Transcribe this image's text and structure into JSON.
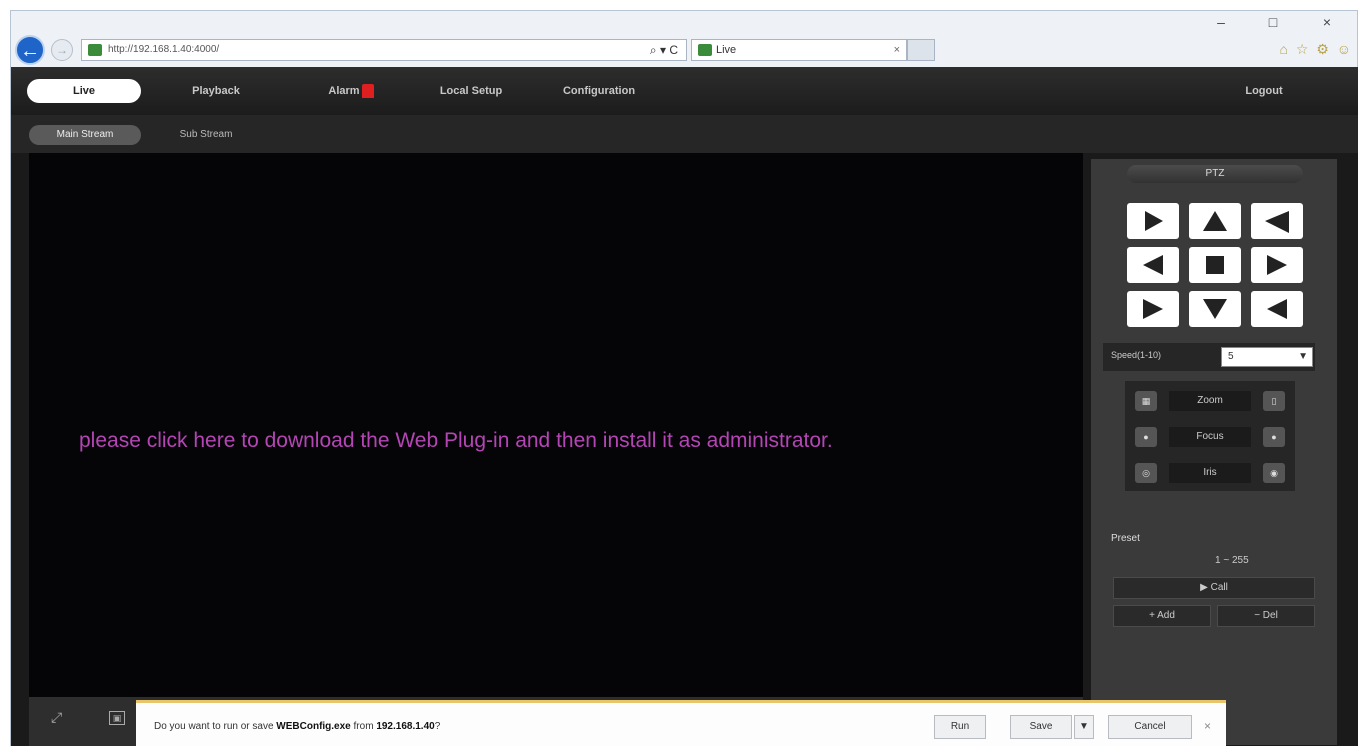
{
  "browser": {
    "url": "http://192.168.1.40:4000/",
    "url_tools": "⌕ ▾ C",
    "tab_title": "Live",
    "tab_close": "×",
    "window_minimize": "–",
    "window_maximize": "□",
    "window_close": "×",
    "toolbar_icons": "⌂ ☆ ⚙ ☺"
  },
  "topnav": {
    "items": [
      "Live",
      "Playback",
      "Alarm",
      "Local Setup",
      "Configuration"
    ],
    "logout": "Logout"
  },
  "subnav": {
    "items": [
      "Main Stream",
      "Sub Stream"
    ]
  },
  "video": {
    "plugin_message": "please click here to download the Web Plug-in and then install it as administrator."
  },
  "ptz": {
    "title": "PTZ",
    "speed_label": "Speed(1-10)",
    "speed_value": "5",
    "zoom_label": "Zoom",
    "focus_label": "Focus",
    "iris_label": "Iris",
    "preset_label": "Preset",
    "preset_range": "1 ~ 255",
    "call_label": "▶ Call",
    "add_label": "+ Add",
    "del_label": "− Del"
  },
  "download_bar": {
    "text_prefix": "Do you want to run or save ",
    "filename": "WEBConfig.exe",
    "text_middle": " from ",
    "source": "192.168.1.40",
    "text_suffix": "?",
    "run_label": "Run",
    "save_label": "Save",
    "cancel_label": "Cancel",
    "close": "×"
  },
  "colors": {
    "plugin_message": "#b545b5",
    "app_background": "#1a1a1a",
    "video_background": "#050507",
    "notification_accent": "#e8c46a"
  }
}
